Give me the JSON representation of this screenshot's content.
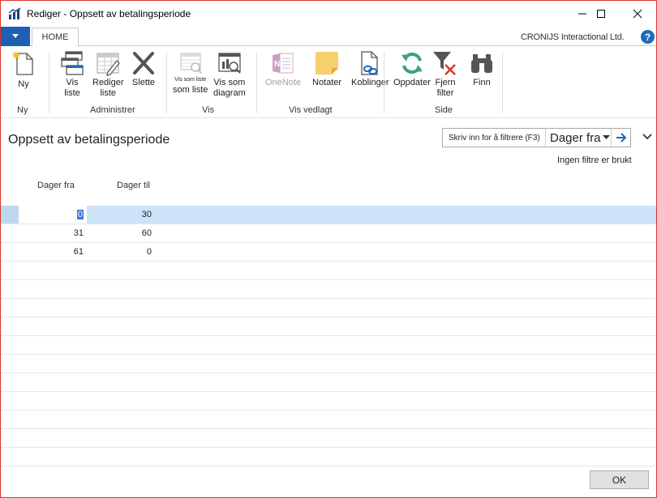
{
  "window": {
    "title": "Rediger - Oppsett av betalingsperiode"
  },
  "tabs": {
    "home_label": "HOME"
  },
  "company": "CRONIJS Interactional Ltd.",
  "ribbon": {
    "new_label": "Ny",
    "group_new": "Ny",
    "view_list_label_1": "Vis",
    "view_list_label_2": "liste",
    "edit_list_label_1": "Rediger",
    "edit_list_label_2": "liste",
    "delete_label": "Slette",
    "group_manage": "Administrer",
    "show_as_list_small": "Vis som liste",
    "show_as_list_label": "som liste",
    "show_as_chart_label_1": "Vis som",
    "show_as_chart_label_2": "diagram",
    "group_view": "Vis",
    "onenote_label": "OneNote",
    "notes_label": "Notater",
    "links_label": "Koblinger",
    "group_attached": "Vis vedlagt",
    "refresh_label": "Oppdater",
    "clear_filter_label_1": "Fjern",
    "clear_filter_label_2": "filter",
    "find_label": "Finn",
    "group_page": "Side"
  },
  "page": {
    "title": "Oppsett av betalingsperiode",
    "filter_placeholder": "Skriv inn for å filtrere (F3)",
    "filter_field": "Dager fra",
    "no_filters": "Ingen filtre er brukt"
  },
  "table": {
    "columns": [
      "Dager fra",
      "Dager til"
    ],
    "rows": [
      {
        "from": "0",
        "to": "30"
      },
      {
        "from": "31",
        "to": "60"
      },
      {
        "from": "61",
        "to": "0"
      }
    ]
  },
  "footer": {
    "ok_label": "OK"
  },
  "colors": {
    "accent": "#1e5fb5",
    "selected_row": "#cde3f7",
    "window_border": "#d9342b"
  }
}
